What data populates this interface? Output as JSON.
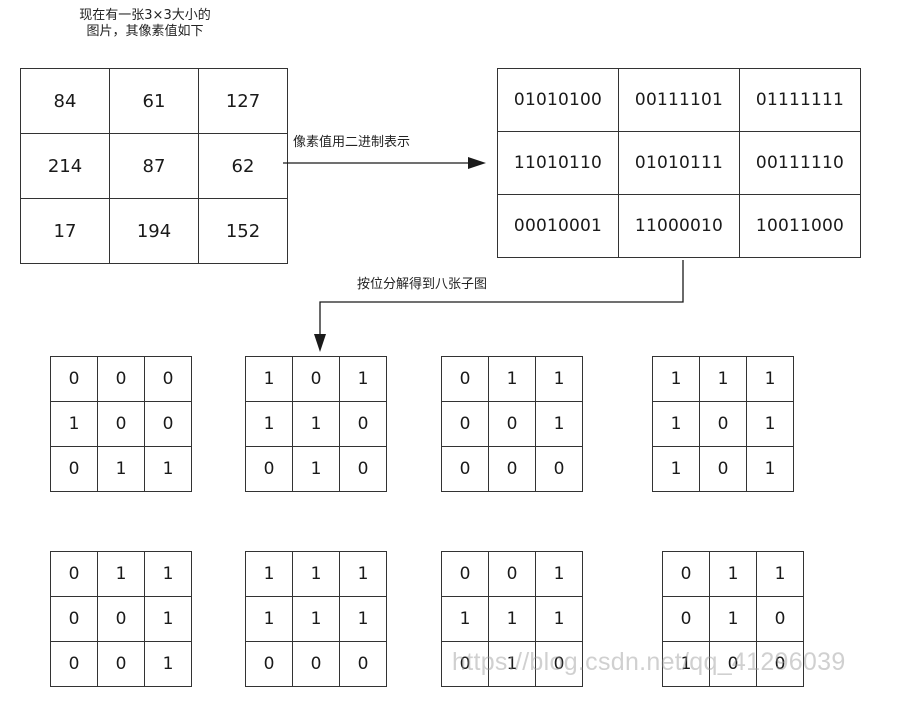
{
  "caption": {
    "line1": "现在有一张3×3大小的",
    "line2": "图片，其像素值如下"
  },
  "arrow_labels": {
    "to_binary": "像素值用二进制表示",
    "decompose": "按位分解得到八张子图"
  },
  "pixel_matrix": [
    [
      "84",
      "61",
      "127"
    ],
    [
      "214",
      "87",
      "62"
    ],
    [
      "17",
      "194",
      "152"
    ]
  ],
  "binary_matrix": [
    [
      "01010100",
      "00111101",
      "01111111"
    ],
    [
      "11010110",
      "01010111",
      "00111110"
    ],
    [
      "00010001",
      "11000010",
      "10011000"
    ]
  ],
  "bit_planes": [
    [
      [
        "0",
        "0",
        "0"
      ],
      [
        "1",
        "0",
        "0"
      ],
      [
        "0",
        "1",
        "1"
      ]
    ],
    [
      [
        "1",
        "0",
        "1"
      ],
      [
        "1",
        "1",
        "0"
      ],
      [
        "0",
        "1",
        "0"
      ]
    ],
    [
      [
        "0",
        "1",
        "1"
      ],
      [
        "0",
        "0",
        "1"
      ],
      [
        "0",
        "0",
        "0"
      ]
    ],
    [
      [
        "1",
        "1",
        "1"
      ],
      [
        "1",
        "0",
        "1"
      ],
      [
        "1",
        "0",
        "1"
      ]
    ],
    [
      [
        "0",
        "1",
        "1"
      ],
      [
        "0",
        "0",
        "1"
      ],
      [
        "0",
        "0",
        "1"
      ]
    ],
    [
      [
        "1",
        "1",
        "1"
      ],
      [
        "1",
        "1",
        "1"
      ],
      [
        "0",
        "0",
        "0"
      ]
    ],
    [
      [
        "0",
        "0",
        "1"
      ],
      [
        "1",
        "1",
        "1"
      ],
      [
        "0",
        "1",
        "0"
      ]
    ],
    [
      [
        "0",
        "1",
        "1"
      ],
      [
        "0",
        "1",
        "0"
      ],
      [
        "1",
        "0",
        "0"
      ]
    ]
  ],
  "watermark": "https://blog.csdn.net/qq_41296039"
}
